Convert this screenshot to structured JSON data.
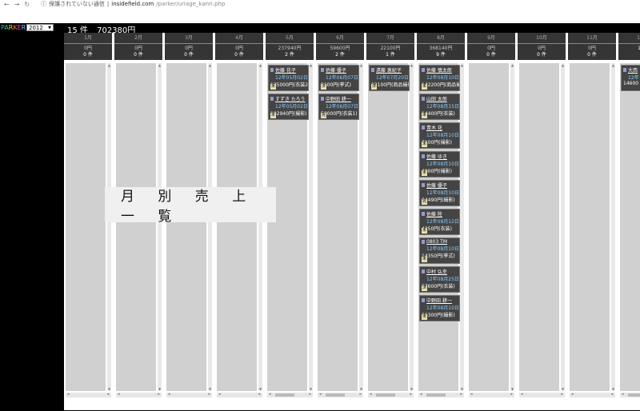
{
  "browser": {
    "not_secure": "保護されていない通信",
    "host": "insidefield.com",
    "path": "/parker/uriage_kanri.php"
  },
  "app": {
    "logo": [
      "P",
      "A",
      "R",
      "K",
      "E",
      "R"
    ],
    "year": "2012",
    "count": "15 件",
    "total": "702380円"
  },
  "overlay_title": "月 別 売 上 一 覧",
  "months": [
    {
      "label": "1月",
      "amount": "0円",
      "count": "0 件",
      "cards": []
    },
    {
      "label": "2月",
      "amount": "0円",
      "count": "0 件",
      "cards": []
    },
    {
      "label": "3月",
      "amount": "0円",
      "count": "0 件",
      "cards": []
    },
    {
      "label": "4月",
      "amount": "0円",
      "count": "0 件",
      "cards": []
    },
    {
      "label": "5月",
      "amount": "237940円",
      "count": "2 件",
      "cards": [
        {
          "name": "佐藤 花子",
          "date": "12年05月02日",
          "amount": "135000円(衣装2",
          "tag": "未"
        },
        {
          "name": "すずき たろう",
          "date": "12年05月02日",
          "amount": "102940円(撮影)",
          "tag": "未"
        }
      ]
    },
    {
      "label": "6月",
      "amount": "59600円",
      "count": "2 件",
      "cards": [
        {
          "name": "佐藤 優子",
          "date": "12年06月07日",
          "amount": "9600円(挙式)",
          "tag": "済"
        },
        {
          "name": "中野田 耕一",
          "date": "12年06月07日",
          "amount": "50000円(衣装1)",
          "tag": "完"
        }
      ]
    },
    {
      "label": "7月",
      "amount": "22100円",
      "count": "1 件",
      "cards": [
        {
          "name": "遠藤 恵紀子",
          "date": "12年07月20日",
          "amount": "22100円(商品撮影)",
          "tag": "済"
        }
      ]
    },
    {
      "label": "8月",
      "amount": "368140円",
      "count": "9 件",
      "cards": [
        {
          "name": "佐藤 慎太郎",
          "date": "12年08月10日",
          "amount": "142200円(商品撮",
          "tag": "未"
        },
        {
          "name": "山田 太郎",
          "date": "12年08月15日",
          "amount": "14400円(衣装)",
          "tag": "未"
        },
        {
          "name": "青木 花",
          "date": "12年08月10日",
          "amount": "7100円(撮影)",
          "tag": "未"
        },
        {
          "name": "佐藤 ゆき",
          "date": "12年08月10日",
          "amount": "4900円(撮影)",
          "tag": "未"
        },
        {
          "name": "佐藤 優子",
          "date": "12年08月10日",
          "amount": "34490円(撮影)",
          "tag": "完"
        },
        {
          "name": "佐藤 陸",
          "date": "12年08月12日",
          "amount": "4250円(衣装)",
          "tag": "未"
        },
        {
          "name": "0803 TM",
          "date": "12年08月10日",
          "amount": "14350円(挙式)",
          "tag": "未"
        },
        {
          "name": "中村 弘幸",
          "date": "12年08月25日",
          "amount": "37600円(衣装)",
          "tag": "済"
        },
        {
          "name": "中野田 耕一",
          "date": "12年08月10日",
          "amount": "26300円(撮影)",
          "tag": "未"
        }
      ]
    },
    {
      "label": "9月",
      "amount": "0円",
      "count": "0 件",
      "cards": []
    },
    {
      "label": "10月",
      "amount": "0円",
      "count": "0 件",
      "cards": []
    },
    {
      "label": "11月",
      "amount": "0円",
      "count": "0 件",
      "cards": []
    },
    {
      "label": "12月",
      "amount": "",
      "count": "1 件",
      "cards": [
        {
          "name": "大西",
          "date": "12年",
          "amount": "14600",
          "tag": ""
        }
      ]
    }
  ]
}
